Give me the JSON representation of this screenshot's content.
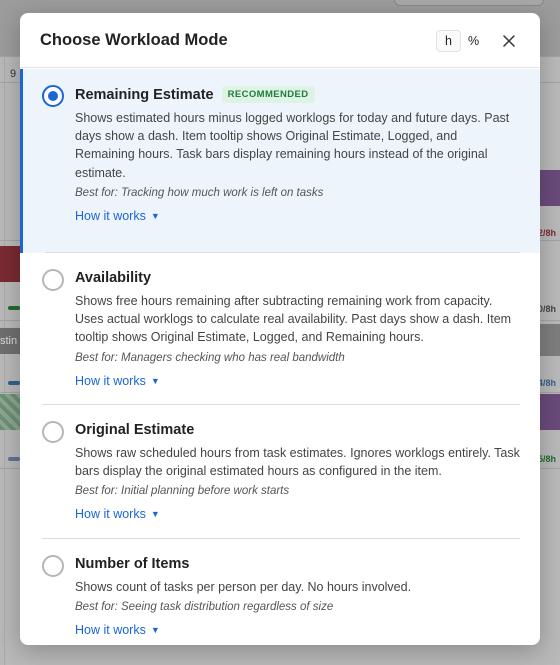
{
  "modal": {
    "title": "Choose Workload Mode",
    "unit_toggle": {
      "hours_label": "h",
      "percent_label": "%",
      "active": "h"
    },
    "close_icon": "close-icon"
  },
  "options": [
    {
      "title": "Remaining Estimate",
      "badge": "RECOMMENDED",
      "selected": true,
      "description": "Shows estimated hours minus logged worklogs for today and future days. Past days show a dash. Item tooltip shows Original Estimate, Logged, and Remaining hours. Task bars display remaining hours instead of the original estimate.",
      "best_for": "Best for: Tracking how much work is left on tasks",
      "how_label": "How it works"
    },
    {
      "title": "Availability",
      "selected": false,
      "description": "Shows free hours remaining after subtracting remaining work from capacity. Uses actual worklogs to calculate real availability. Past days show a dash. Item tooltip shows Original Estimate, Logged, and Remaining hours.",
      "best_for": "Best for: Managers checking who has real bandwidth",
      "how_label": "How it works"
    },
    {
      "title": "Original Estimate",
      "selected": false,
      "description": "Shows raw scheduled hours from task estimates. Ignores worklogs entirely. Task bars display the original estimated hours as configured in the item.",
      "best_for": "Best for: Initial planning before work starts",
      "how_label": "How it works"
    },
    {
      "title": "Number of Items",
      "selected": false,
      "description": "Shows count of tasks per person per day. No hours involved.",
      "best_for": "Best for: Seeing task distribution regardless of size",
      "how_label": "How it works"
    }
  ],
  "background": {
    "day_number": "9",
    "row_label": "stin",
    "right_labels": [
      "2/8h",
      "0/8h",
      "4/8h",
      "5/8h"
    ]
  },
  "colors": {
    "accent": "#1a66d6",
    "badge_text": "#1e7d3a",
    "badge_bg": "#dff3e4",
    "selected_bg": "#eef4fc"
  }
}
